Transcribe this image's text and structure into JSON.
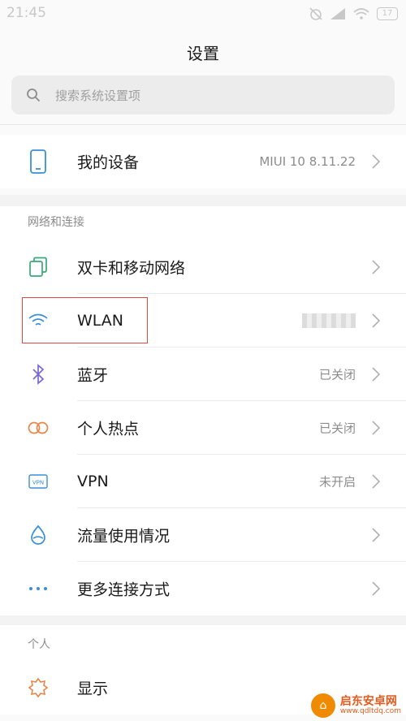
{
  "statusbar": {
    "time": "21:45",
    "battery": "17"
  },
  "title": "设置",
  "search": {
    "placeholder": "搜索系统设置项"
  },
  "device": {
    "label": "我的设备",
    "value": "MIUI 10 8.11.22"
  },
  "network_section": {
    "header": "网络和连接",
    "items": [
      {
        "label": "双卡和移动网络",
        "value": "",
        "icon": "dual-sim-icon"
      },
      {
        "label": "WLAN",
        "value": "",
        "icon": "wifi-icon"
      },
      {
        "label": "蓝牙",
        "value": "已关闭",
        "icon": "bluetooth-icon"
      },
      {
        "label": "个人热点",
        "value": "已关闭",
        "icon": "hotspot-icon"
      },
      {
        "label": "VPN",
        "value": "未开启",
        "icon": "vpn-icon"
      },
      {
        "label": "流量使用情况",
        "value": "",
        "icon": "data-usage-icon"
      },
      {
        "label": "更多连接方式",
        "value": "",
        "icon": "more-icon"
      }
    ]
  },
  "personal_section": {
    "header": "个人",
    "items": [
      {
        "label": "显示",
        "value": "",
        "icon": "display-icon"
      }
    ]
  },
  "watermark": {
    "name": "启东安卓网",
    "url": "www.qdltdq.com"
  },
  "colors": {
    "accent": "#3a8fd6",
    "highlight": "#e04a3c",
    "bluetooth": "#7b66d6",
    "hotspot": "#e8864a",
    "display": "#e8864a"
  }
}
